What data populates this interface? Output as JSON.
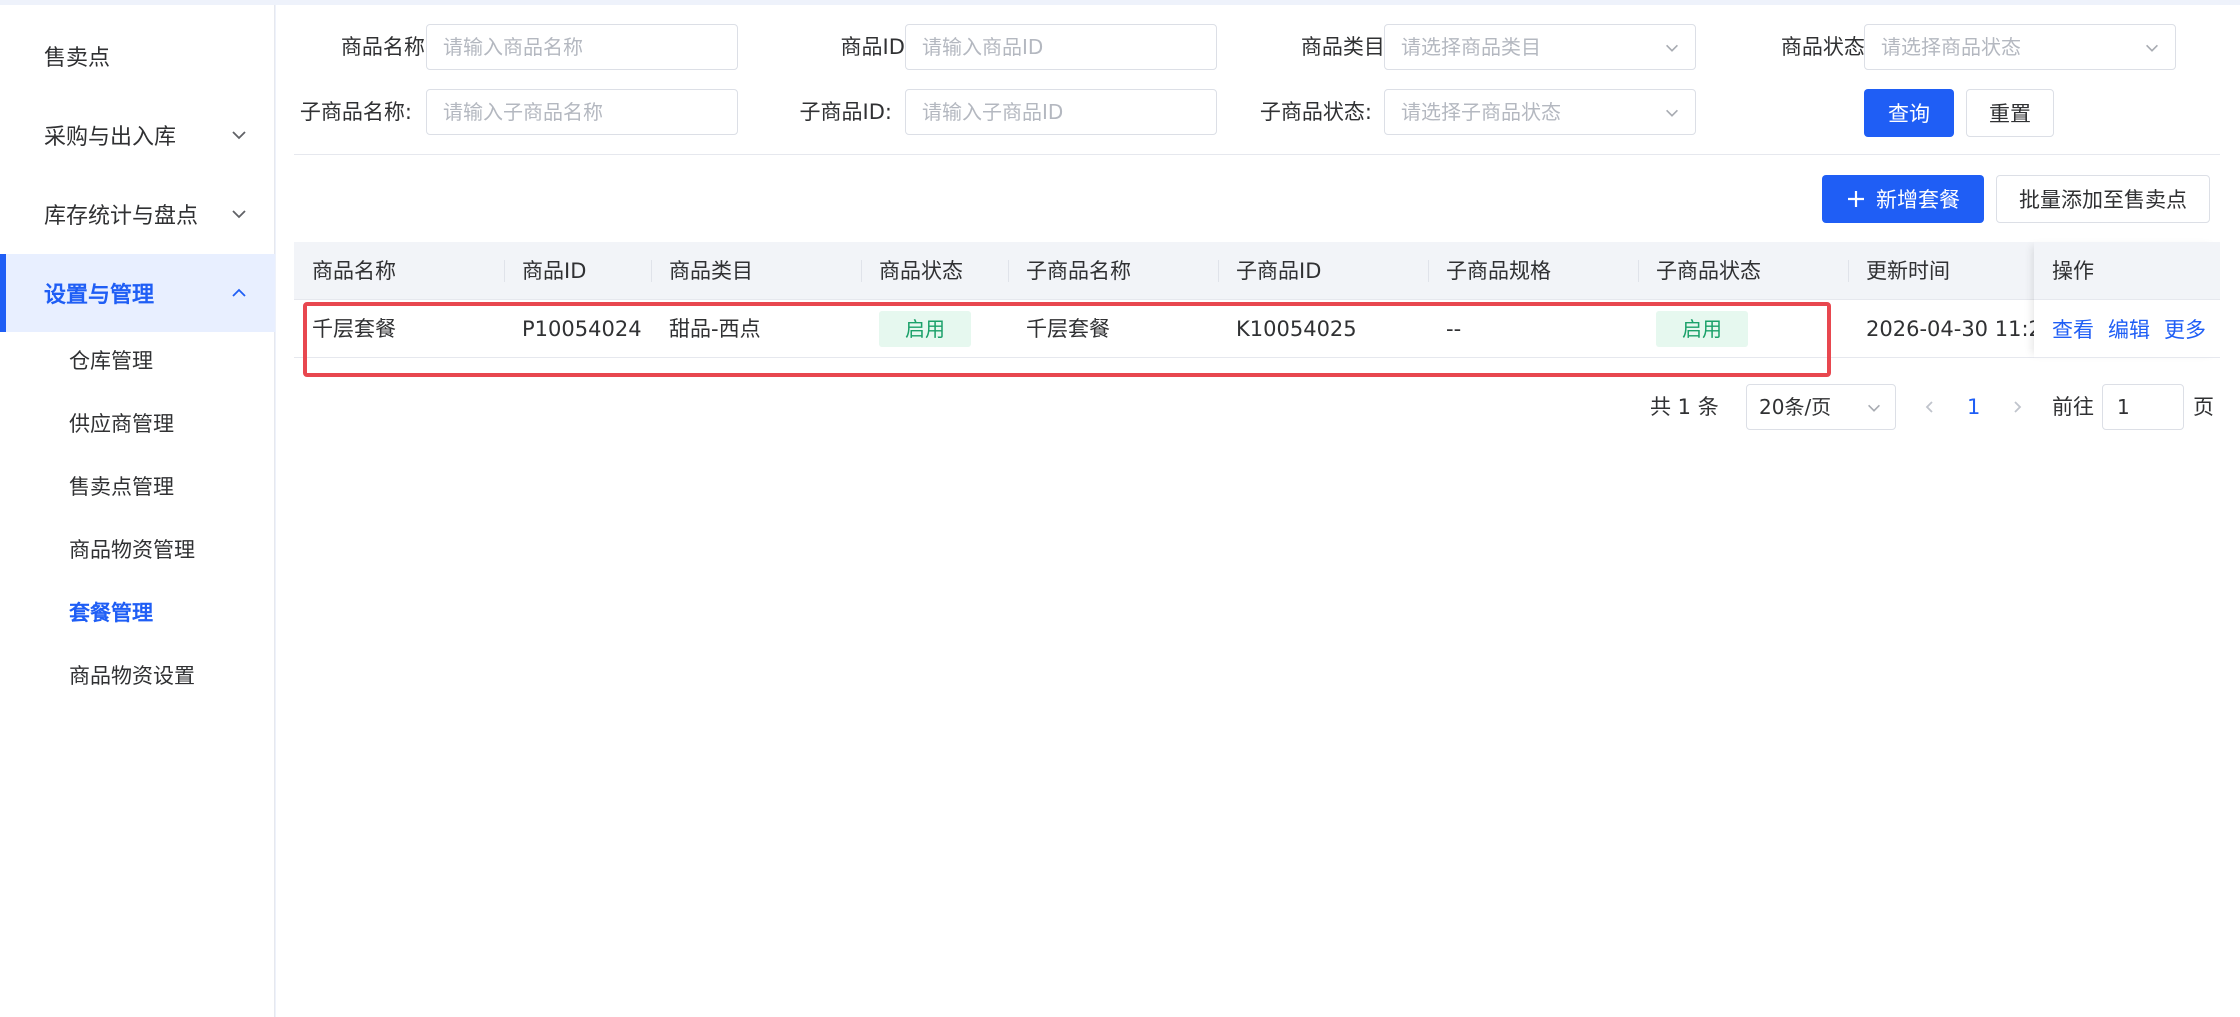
{
  "sidebar": {
    "items": [
      {
        "label": "售卖点"
      },
      {
        "label": "采购与出入库"
      },
      {
        "label": "库存统计与盘点"
      },
      {
        "label": "设置与管理"
      }
    ],
    "subitems": [
      {
        "label": "仓库管理"
      },
      {
        "label": "供应商管理"
      },
      {
        "label": "售卖点管理"
      },
      {
        "label": "商品物资管理"
      },
      {
        "label": "套餐管理"
      },
      {
        "label": "商品物资设置"
      }
    ]
  },
  "filters": {
    "product_name": {
      "label": "商品名称:",
      "placeholder": "请输入商品名称"
    },
    "product_id": {
      "label": "商品ID:",
      "placeholder": "请输入商品ID"
    },
    "category": {
      "label": "商品类目:",
      "placeholder": "请选择商品类目"
    },
    "status": {
      "label": "商品状态:",
      "placeholder": "请选择商品状态"
    },
    "sub_name": {
      "label": "子商品名称:",
      "placeholder": "请输入子商品名称"
    },
    "sub_id": {
      "label": "子商品ID:",
      "placeholder": "请输入子商品ID"
    },
    "sub_status": {
      "label": "子商品状态:",
      "placeholder": "请选择子商品状态"
    },
    "query_label": "查询",
    "reset_label": "重置"
  },
  "toolbar": {
    "add_label": "新增套餐",
    "batch_label": "批量添加至售卖点"
  },
  "table": {
    "columns": [
      "商品名称",
      "商品ID",
      "商品类目",
      "商品状态",
      "子商品名称",
      "子商品ID",
      "子商品规格",
      "子商品状态",
      "更新时间"
    ],
    "ops_header": "操作",
    "rows": [
      {
        "name": "千层套餐",
        "id": "P10054024",
        "category": "甜品-西点",
        "status": "启用",
        "sub_name": "千层套餐",
        "sub_id": "K10054025",
        "sub_spec": "--",
        "sub_status": "启用",
        "updated": "2026-04-30 11:2",
        "ops": [
          "查看",
          "编辑",
          "更多"
        ]
      }
    ]
  },
  "pagination": {
    "total": "共 1 条",
    "page_size": "20条/页",
    "current": "1",
    "goto_label": "前往",
    "goto_value": "1",
    "page_suffix": "页"
  },
  "colors": {
    "primary": "#1f5ef5",
    "enabled_tag_bg": "#e6f8ef",
    "enabled_tag_text": "#1ba16a",
    "highlight": "#e8474f"
  }
}
